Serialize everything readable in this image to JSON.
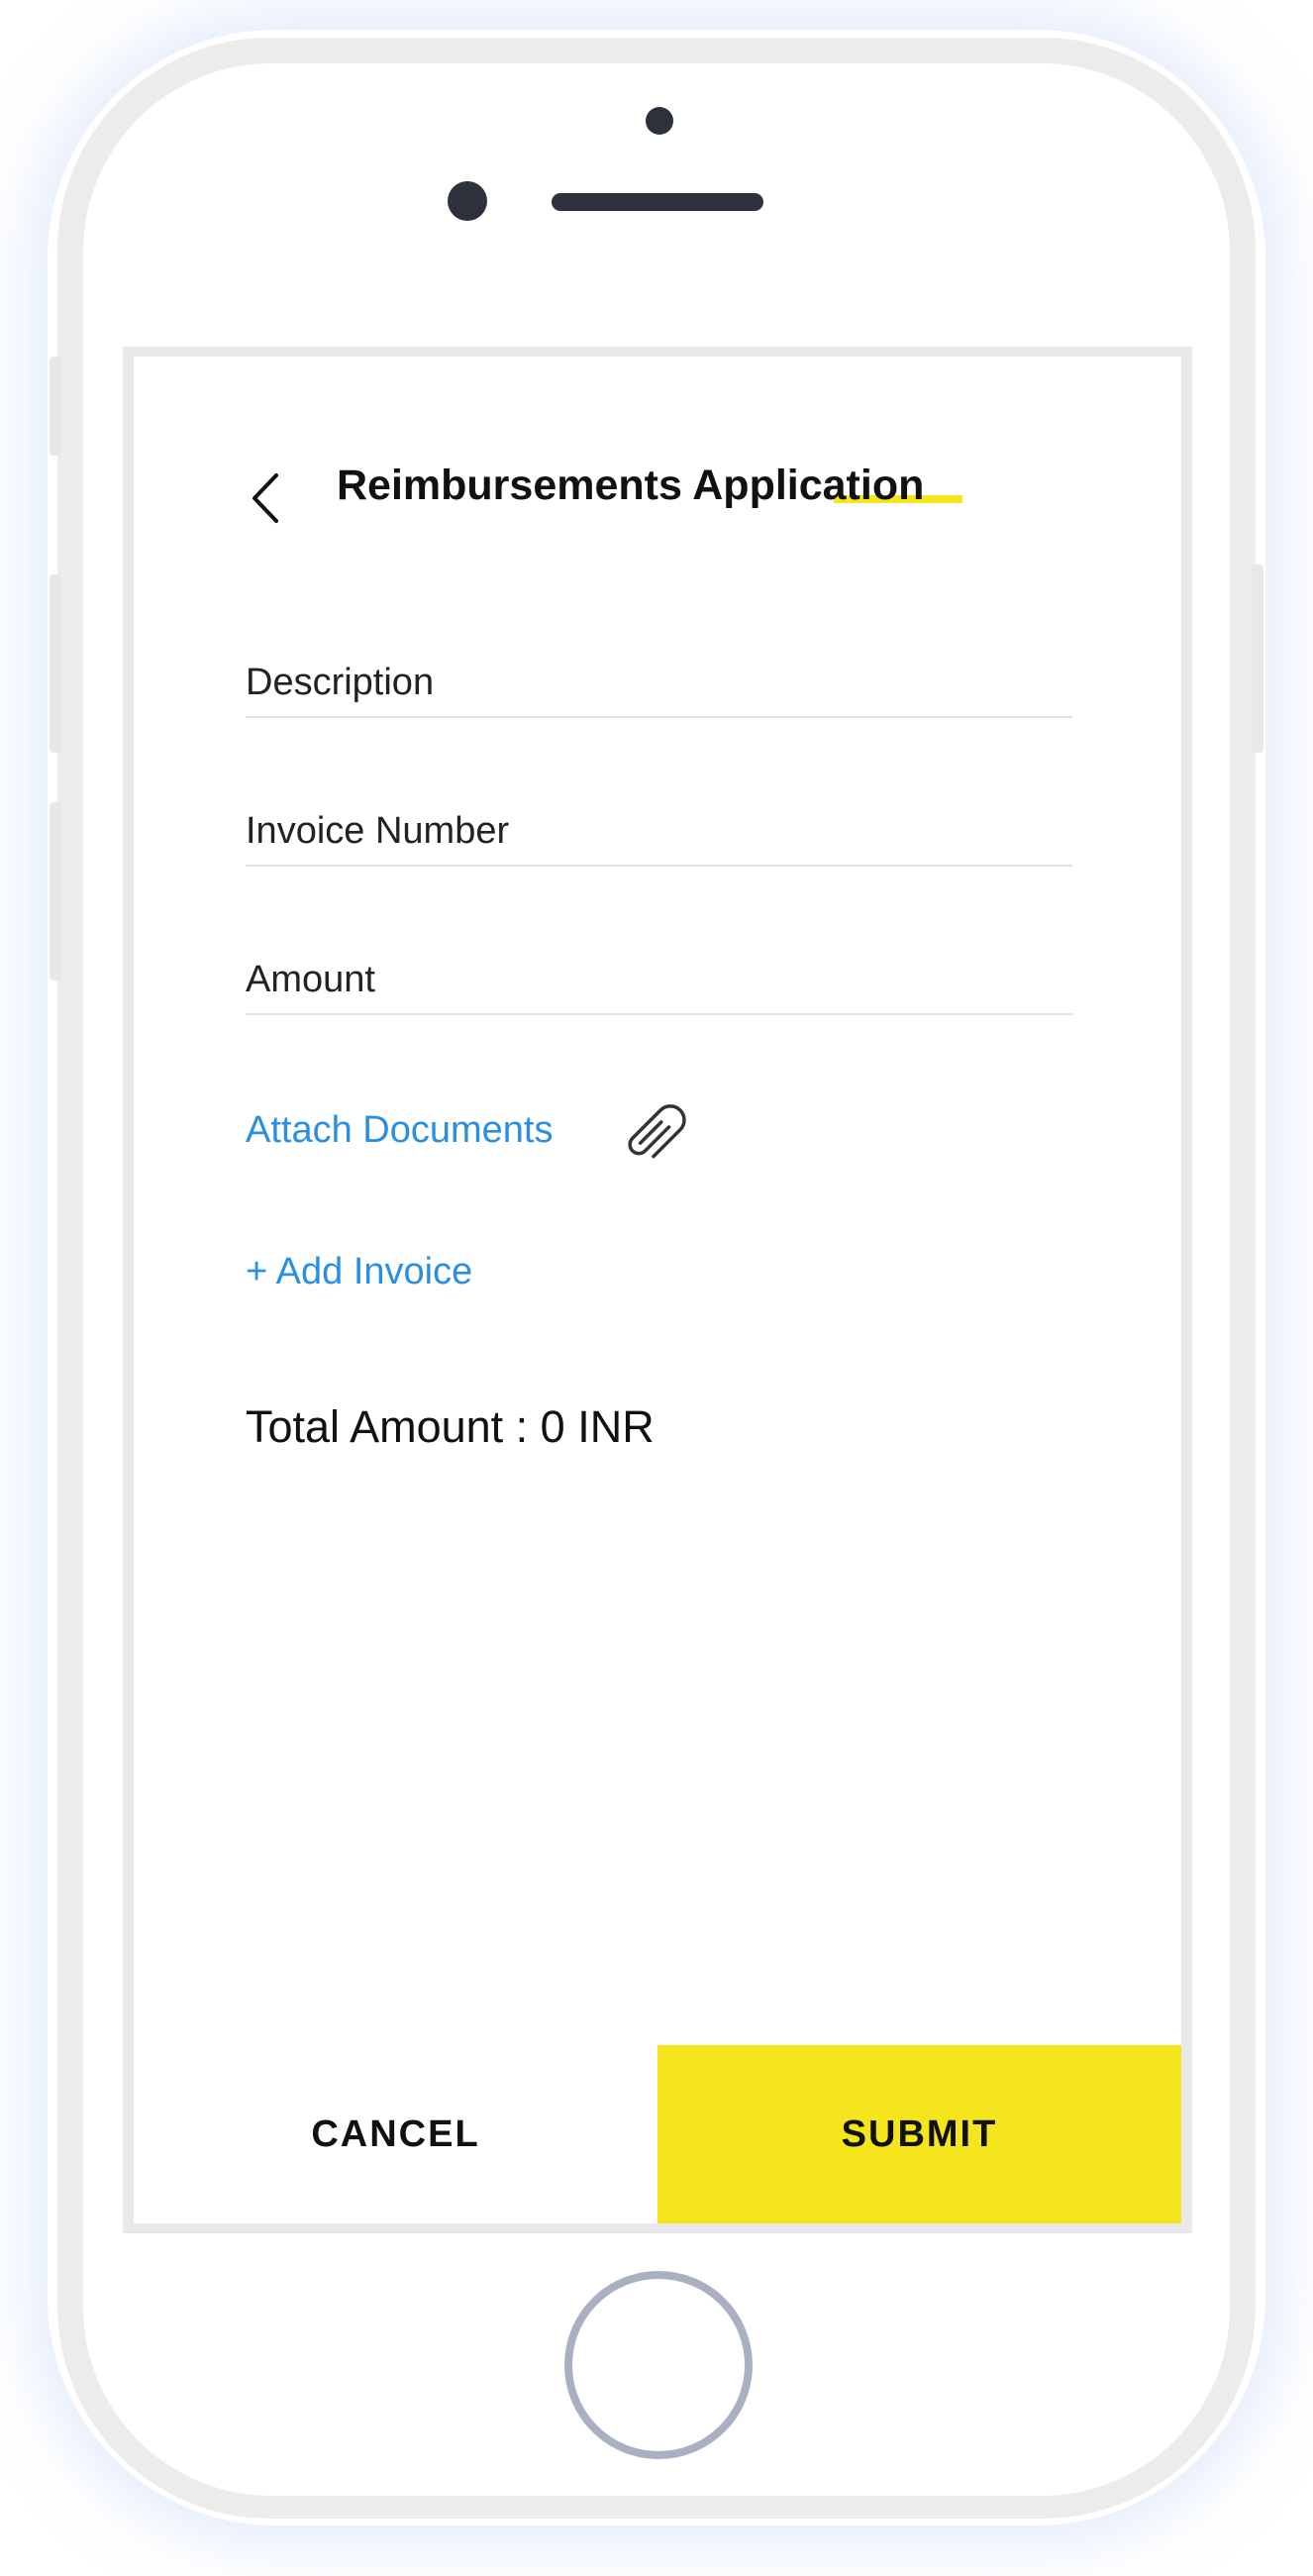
{
  "header": {
    "title": "Reimbursements Application",
    "accent_color": "#f5e51c"
  },
  "form": {
    "description": {
      "placeholder": "Description",
      "value": ""
    },
    "invoice_number": {
      "placeholder": "Invoice Number",
      "value": ""
    },
    "amount": {
      "placeholder": "Amount",
      "value": ""
    },
    "attach_documents_label": "Attach Documents",
    "add_invoice_label": "+ Add Invoice",
    "total_amount": "Total Amount : 0 INR"
  },
  "actions": {
    "cancel_label": "CANCEL",
    "submit_label": "SUBMIT"
  },
  "colors": {
    "link": "#2a8fe3",
    "primary_button": "#f5e51c",
    "text": "#111111"
  },
  "icons": {
    "back": "chevron-left-icon",
    "attach": "paperclip-icon"
  }
}
